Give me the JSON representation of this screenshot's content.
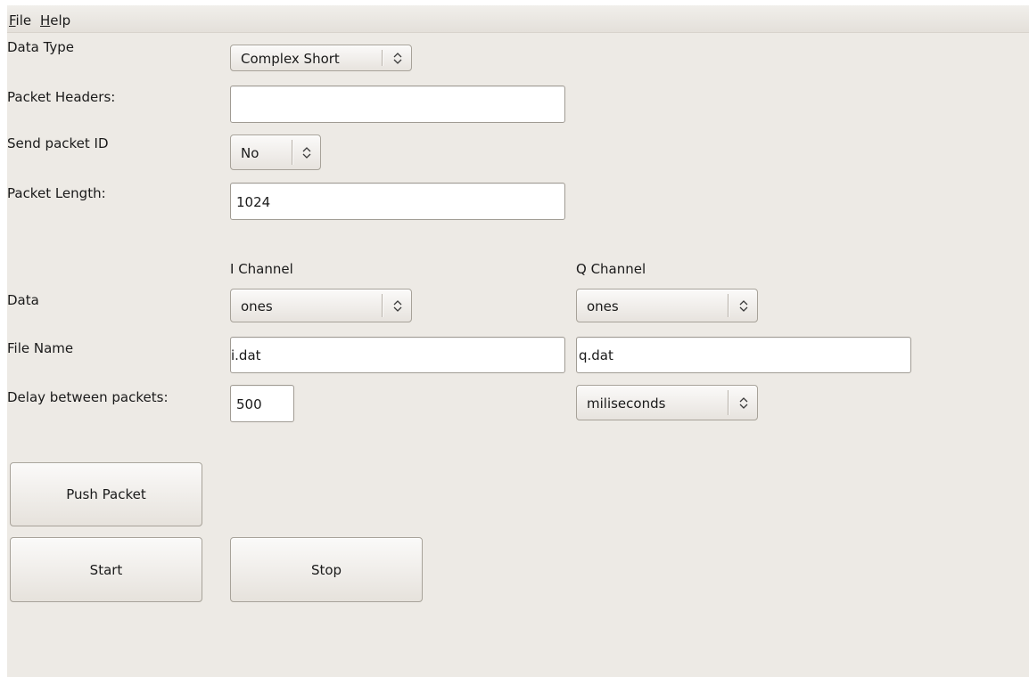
{
  "menu": {
    "file_underline": "F",
    "file_rest": "ile",
    "help_underline": "H",
    "help_rest": "elp"
  },
  "form": {
    "data_type": {
      "label": "Data Type",
      "value": "Complex Short"
    },
    "packet_headers": {
      "label": "Packet Headers:",
      "value": ""
    },
    "send_packet_id": {
      "label": "Send packet ID",
      "value": "No"
    },
    "packet_length": {
      "label": "Packet Length:",
      "value": "1024"
    }
  },
  "channels": {
    "i_header": "I Channel",
    "q_header": "Q Channel",
    "data_label": "Data",
    "i_data": "ones",
    "q_data": "ones",
    "file_name_label": "File Name",
    "i_file": "i.dat",
    "q_file": "q.dat",
    "delay_label": "Delay between packets:",
    "delay_value": "500",
    "delay_unit": "miliseconds"
  },
  "buttons": {
    "push_packet": "Push Packet",
    "start": "Start",
    "stop": "Stop"
  }
}
